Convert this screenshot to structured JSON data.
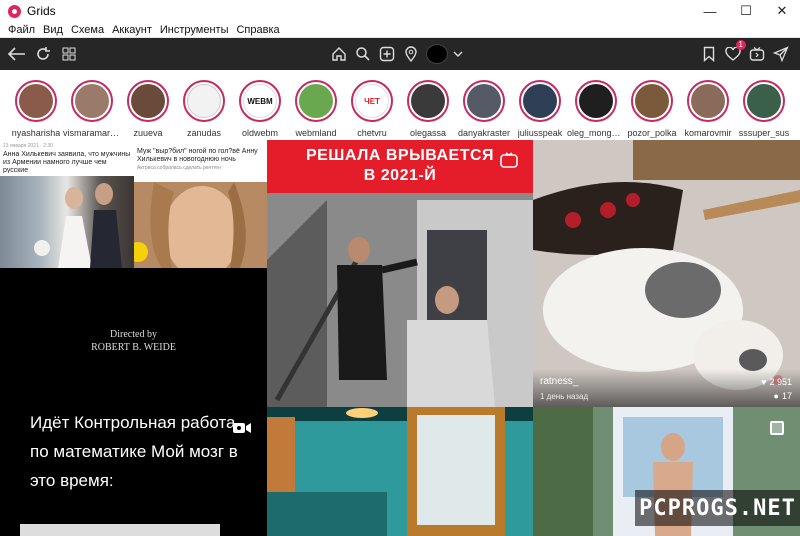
{
  "window": {
    "title": "Grids",
    "minimize": "—",
    "maximize": "☐",
    "close": "✕"
  },
  "menu": [
    "Файл",
    "Вид",
    "Схема",
    "Аккаунт",
    "Инструменты",
    "Справка"
  ],
  "toolbar": {
    "notification_count": "1"
  },
  "stories": [
    {
      "label": "nyasharisha",
      "color": "#8a5a4a"
    },
    {
      "label": "vismaramartina",
      "color": "#9a7a68"
    },
    {
      "label": "zuueva",
      "color": "#6a4a3a"
    },
    {
      "label": "zanudas",
      "color": "#f2f2f2"
    },
    {
      "label": "oldwebm",
      "color": "#ffffff",
      "text": "WEBM"
    },
    {
      "label": "webmland",
      "color": "#6aa84f"
    },
    {
      "label": "chetvru",
      "color": "#ffffff",
      "text": "ЧЕТ"
    },
    {
      "label": "olegassa",
      "color": "#3a3a3a"
    },
    {
      "label": "danyakraster",
      "color": "#555b66"
    },
    {
      "label": "juliusspeak",
      "color": "#2f3f55"
    },
    {
      "label": "oleg_mongol_...",
      "color": "#1f1f1f"
    },
    {
      "label": "pozor_polka",
      "color": "#7a5a3a"
    },
    {
      "label": "komarovmir",
      "color": "#8a6a5a"
    },
    {
      "label": "sssuper_sus",
      "color": "#3a5f4a"
    }
  ],
  "posts": {
    "news1": {
      "meta": "13 января 2021 · 2:30",
      "headline": "Анна Хилькевич заявила, что мужчины из Армении намного лучше чем русские"
    },
    "news2": {
      "headline": "Муж \"выр?бил\" ногой по гол?вё Анну Хилькевич в новогоднюю ночь",
      "sub": "Актриса собралась сделать рентген"
    },
    "video": {
      "directed": "Directed by",
      "director": "ROBERT B. WEIDE",
      "caption": "Идёт Контрольная работа по математике Мой мозг в это время:"
    },
    "banner": {
      "line1": "РЕШАЛА ВРЫВАЕТСЯ",
      "line2": "В 2021-Й"
    },
    "rat": {
      "username": "ratness_",
      "time": "1 день назад",
      "likes": "2 951",
      "comments": "17"
    }
  },
  "watermark": "PCPROGS.NET"
}
